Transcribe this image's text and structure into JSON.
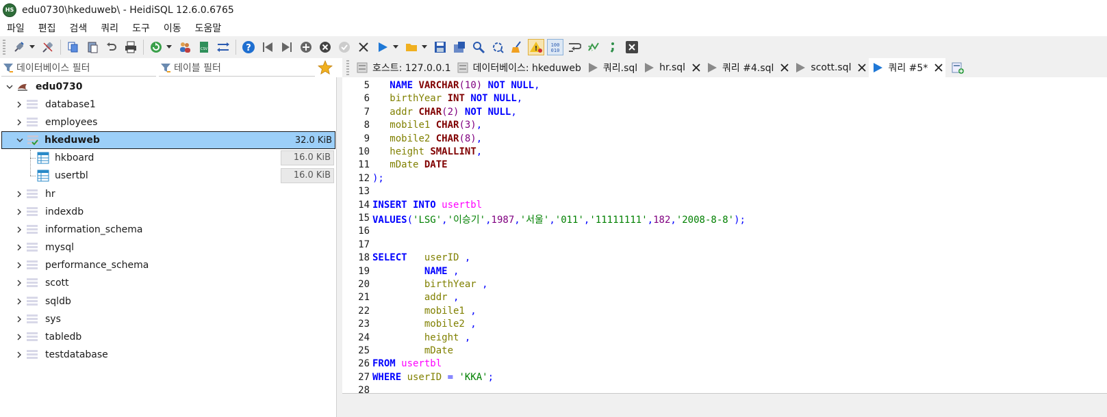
{
  "window": {
    "title": "edu0730\\hkeduweb\\ - HeidiSQL 12.6.0.6765",
    "app_icon_text": "HS"
  },
  "menu": [
    "파일",
    "편집",
    "검색",
    "쿼리",
    "도구",
    "이동",
    "도움말"
  ],
  "filters": {
    "database_placeholder": "데이터베이스 필터",
    "table_placeholder": "테이블 필터"
  },
  "tabs": [
    {
      "label": "호스트: 127.0.0.1",
      "icon": "host-icon",
      "closable": false
    },
    {
      "label": "데이터베이스: hkeduweb",
      "icon": "database-icon",
      "closable": false
    },
    {
      "label": "쿼리.sql",
      "icon": "play-icon",
      "closable": false
    },
    {
      "label": "hr.sql",
      "icon": "play-icon",
      "closable": true
    },
    {
      "label": "쿼리 #4.sql",
      "icon": "play-icon",
      "closable": true
    },
    {
      "label": "scott.sql",
      "icon": "play-icon",
      "closable": true
    },
    {
      "label": "쿼리 #5*",
      "icon": "play-icon",
      "closable": true,
      "active": true
    }
  ],
  "tree": {
    "root": "edu0730",
    "databases": [
      {
        "name": "database1"
      },
      {
        "name": "employees"
      },
      {
        "name": "hkeduweb",
        "size": "32.0 KiB",
        "selected": true,
        "expanded": true,
        "tables": [
          {
            "name": "hkboard",
            "size": "16.0 KiB"
          },
          {
            "name": "usertbl",
            "size": "16.0 KiB"
          }
        ]
      },
      {
        "name": "hr"
      },
      {
        "name": "indexdb"
      },
      {
        "name": "information_schema"
      },
      {
        "name": "mysql"
      },
      {
        "name": "performance_schema"
      },
      {
        "name": "scott"
      },
      {
        "name": "sqldb"
      },
      {
        "name": "sys"
      },
      {
        "name": "tabledb"
      },
      {
        "name": "testdatabase"
      }
    ]
  },
  "editor": {
    "line_numbers": [
      "5",
      "6",
      "7",
      "8",
      "9",
      "10",
      "11",
      "12",
      "13",
      "14",
      "15",
      "16",
      "17",
      "18",
      "19",
      "20",
      "21",
      "22",
      "23",
      "24",
      "25",
      "26",
      "27",
      "28"
    ],
    "colors": {
      "keyword": "#0000ff",
      "type": "#800000",
      "identifier": "#808000",
      "table": "#ff00ff",
      "string": "#008000",
      "number": "#800080"
    }
  }
}
